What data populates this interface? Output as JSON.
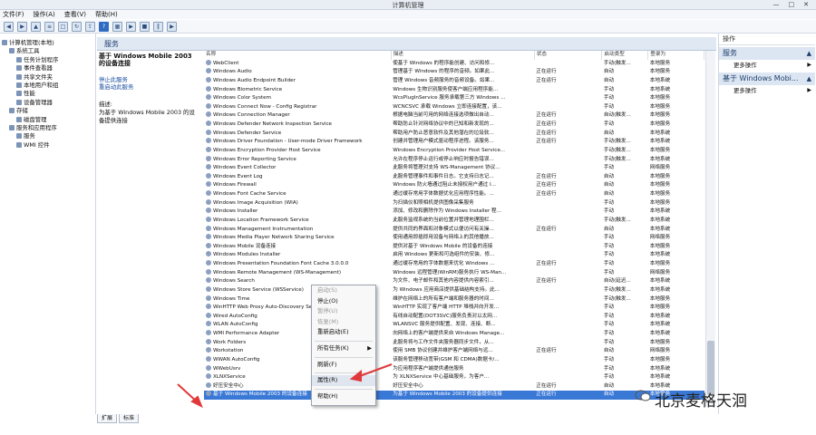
{
  "window": {
    "title": "计算机管理",
    "controls": [
      "—",
      "□",
      "✕"
    ]
  },
  "menu": [
    "文件(F)",
    "操作(A)",
    "查看(V)",
    "帮助(H)"
  ],
  "toolbar_icons": [
    "back-icon",
    "forward-icon",
    "up-icon",
    "show-hide-tree-icon",
    "properties-icon",
    "refresh-icon",
    "export-icon",
    "help-icon",
    "view-icon",
    "play-icon",
    "stop-icon",
    "pause-icon",
    "restart-icon"
  ],
  "tree": [
    {
      "label": "计算机管理(本地)",
      "indent": 0
    },
    {
      "label": "系统工具",
      "indent": 1
    },
    {
      "label": "任务计划程序",
      "indent": 2
    },
    {
      "label": "事件查看器",
      "indent": 2
    },
    {
      "label": "共享文件夹",
      "indent": 2
    },
    {
      "label": "本地用户和组",
      "indent": 2
    },
    {
      "label": "性能",
      "indent": 2
    },
    {
      "label": "设备管理器",
      "indent": 2
    },
    {
      "label": "存储",
      "indent": 1
    },
    {
      "label": "磁盘管理",
      "indent": 2
    },
    {
      "label": "服务和应用程序",
      "indent": 1
    },
    {
      "label": "服务",
      "indent": 2
    },
    {
      "label": "WMI 控件",
      "indent": 2
    }
  ],
  "services_header": "服务",
  "desc_pane": {
    "selected_title": "基于 Windows Mobile 2003 的设备连接",
    "links": [
      "停止此服务",
      "重启动此服务"
    ],
    "desc_label": "描述:",
    "desc_text": "为基于 Windows Mobile 2003 的设备提供连接"
  },
  "columns": [
    "名称",
    "描述",
    "状态",
    "启动类型",
    "登录为"
  ],
  "services": [
    [
      "WebClient",
      "使基于 Windows 的程序能创建、访问和修...",
      "",
      "手动(触发...",
      "本地服务"
    ],
    [
      "Windows Audio",
      "管理基于 Windows 的程序的音频。如果此...",
      "正在运行",
      "自动",
      "本地服务"
    ],
    [
      "Windows Audio Endpoint Builder",
      "管理 Windows 音频服务的音频设备。如果...",
      "正在运行",
      "自动",
      "本地系统"
    ],
    [
      "Windows Biometric Service",
      "Windows 生物识别服务使客户端应用程序能...",
      "",
      "手动",
      "本地系统"
    ],
    [
      "Windows Color System",
      "WcsPlugInService 服务承载第三方 Windows ...",
      "",
      "手动",
      "本地服务"
    ],
    [
      "Windows Connect Now - Config Registrar",
      "WCNCSVC 承载 Windows 立即连接配置，该...",
      "",
      "手动",
      "本地服务"
    ],
    [
      "Windows Connection Manager",
      "根据电脑当前可用的网络连接选项做出自动...",
      "正在运行",
      "自动(触发...",
      "本地服务"
    ],
    [
      "Windows Defender Network Inspection Service",
      "帮助防止针对网络协议中的已知和新发现的...",
      "正在运行",
      "手动",
      "本地服务"
    ],
    [
      "Windows Defender Service",
      "帮助用户防止恶意软件及其他潜在的垃圾软...",
      "正在运行",
      "自动",
      "本地系统"
    ],
    [
      "Windows Driver Foundation - User-mode Driver Framework",
      "创建并管理用户模式驱动程序进程。该服务...",
      "正在运行",
      "手动(触发...",
      "本地系统"
    ],
    [
      "Windows Encryption Provider Host Service",
      "Windows Encryption Provider Host Service...",
      "",
      "手动(触发...",
      "本地服务"
    ],
    [
      "Windows Error Reporting Service",
      "允许在程序停止运行或停止响应时报告错误...",
      "",
      "手动(触发...",
      "本地系统"
    ],
    [
      "Windows Event Collector",
      "此服务将管理对支持 WS-Management 协议...",
      "",
      "手动",
      "网络服务"
    ],
    [
      "Windows Event Log",
      "此服务管理事件和事件日志。它支持日志记...",
      "正在运行",
      "自动",
      "本地服务"
    ],
    [
      "Windows Firewall",
      "Windows 防火墙通过阻止未授权用户通过 I...",
      "正在运行",
      "自动",
      "本地服务"
    ],
    [
      "Windows Font Cache Service",
      "通过缓存常用字体数据优化应用程序性能。...",
      "正在运行",
      "自动",
      "本地服务"
    ],
    [
      "Windows Image Acquisition (WIA)",
      "为扫描仪和照相机提供图像采集服务",
      "",
      "手动",
      "本地服务"
    ],
    [
      "Windows Installer",
      "添加、修改和删除作为 Windows Installer 程...",
      "",
      "手动",
      "本地系统"
    ],
    [
      "Windows Location Framework Service",
      "此服务监视系统的当前位置并管理地理围栏...",
      "",
      "手动(触发...",
      "本地系统"
    ],
    [
      "Windows Management Instrumentation",
      "提供共同的界面和对象模式以便访问有关操...",
      "正在运行",
      "自动",
      "本地系统"
    ],
    [
      "Windows Media Player Network Sharing Service",
      "使用通用即插即用设备与网络上的其他播放...",
      "",
      "手动",
      "网络服务"
    ],
    [
      "Windows Mobile 设备连接",
      "提供对基于 Windows Mobile 的设备的连接",
      "",
      "手动",
      "本地服务"
    ],
    [
      "Windows Modules Installer",
      "启用 Windows 更新和可选组件的安装、修...",
      "",
      "手动",
      "本地系统"
    ],
    [
      "Windows Presentation Foundation Font Cache 3.0.0.0",
      "通过缓存常用的字体数据来优化 Windows ...",
      "正在运行",
      "手动",
      "本地服务"
    ],
    [
      "Windows Remote Management (WS-Management)",
      "Windows 远程管理(WinRM)服务执行 WS-Man...",
      "",
      "手动",
      "网络服务"
    ],
    [
      "Windows Search",
      "为文件、电子邮件和其他内容提供内容索引...",
      "正在运行",
      "自动(延迟...",
      "本地系统"
    ],
    [
      "Windows Store Service (WSService)",
      "为 Windows 应用商店提供基础结构支持。此...",
      "",
      "手动(触发...",
      "本地系统"
    ],
    [
      "Windows Time",
      "维护在网络上的所有客户端和服务器的时间...",
      "",
      "手动(触发...",
      "本地服务"
    ],
    [
      "WinHTTP Web Proxy Auto-Discovery Service",
      "WinHTTP 实现了客户端 HTTP 堆栈并向开发...",
      "",
      "手动",
      "本地服务"
    ],
    [
      "Wired AutoConfig",
      "有线自动配置(DOT3SVC)服务负责对以太网...",
      "",
      "手动",
      "本地系统"
    ],
    [
      "WLAN AutoConfig",
      "WLANSVC 服务提供配置、发现、连接、断...",
      "",
      "手动",
      "本地系统"
    ],
    [
      "WMI Performance Adapter",
      "向网络上的客户端提供来自 Windows Manage...",
      "",
      "手动",
      "本地系统"
    ],
    [
      "Work Folders",
      "此服务将与工作文件夹服务器同步文件，从...",
      "",
      "手动",
      "本地服务"
    ],
    [
      "Workstation",
      "使用 SMB 协议创建并维护客户端网络与远...",
      "正在运行",
      "自动",
      "网络服务"
    ],
    [
      "WWAN AutoConfig",
      "该服务管理移动宽带(GSM 和 CDMA)数据卡/...",
      "",
      "手动",
      "本地服务"
    ],
    [
      "WWebUsrv",
      "为应用程序客户端提供通信服务",
      "",
      "手动",
      "本地系统"
    ],
    [
      "XLNXService",
      "为 XLNXService 中心基础服务，为客户...",
      "",
      "手动",
      "本地系统"
    ],
    [
      "好压安全中心",
      "好压安全中心",
      "正在运行",
      "自动",
      "本地系统"
    ],
    [
      "基于 Windows Mobile 2003 的设备连接",
      "为基于 Windows Mobile 2003 的设备提供连接",
      "正在运行",
      "自动",
      "本地服务"
    ]
  ],
  "selected_index": 38,
  "context_menu": [
    {
      "label": "启动(S)",
      "disabled": true
    },
    {
      "label": "停止(O)",
      "disabled": false
    },
    {
      "label": "暂停(U)",
      "disabled": true
    },
    {
      "label": "恢复(M)",
      "disabled": true
    },
    {
      "label": "重新启动(E)",
      "disabled": false
    },
    {
      "sep": true
    },
    {
      "label": "所有任务(K)",
      "disabled": false,
      "submenu": true
    },
    {
      "sep": true
    },
    {
      "label": "刷新(F)",
      "disabled": false
    },
    {
      "sep": true
    },
    {
      "label": "属性(R)",
      "disabled": false,
      "highlight": true
    },
    {
      "sep": true
    },
    {
      "label": "帮助(H)",
      "disabled": false
    }
  ],
  "bottom_tabs": [
    "扩展",
    "标准"
  ],
  "actions": {
    "header": "操作",
    "sections": [
      {
        "title": "服务",
        "more": "更多操作"
      },
      {
        "title": "基于 Windows Mobi...",
        "more": "更多操作"
      }
    ]
  },
  "watermark": "北京麦格天洄",
  "colors": {
    "accent": "#3a78d6",
    "arrow": "#e0393b",
    "header": "#dfe8f3"
  }
}
